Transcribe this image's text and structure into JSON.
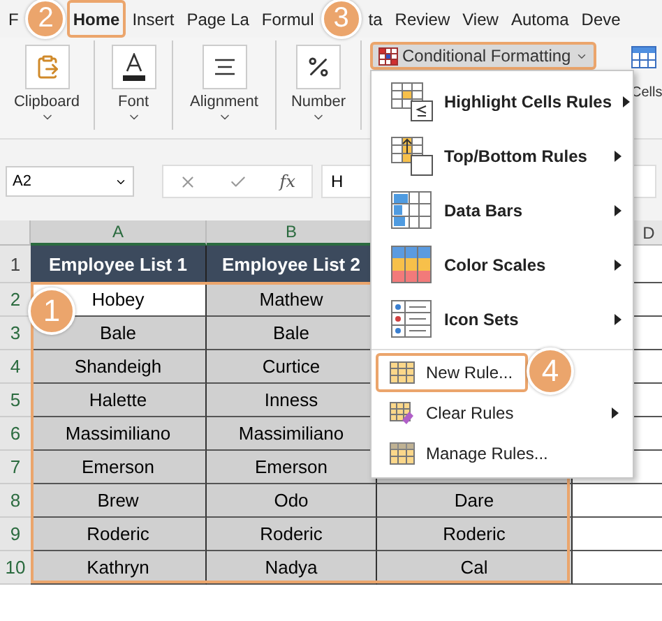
{
  "tabs": [
    {
      "label": "F",
      "selected": false
    },
    {
      "label": "Home",
      "selected": true
    },
    {
      "label": "Insert",
      "selected": false
    },
    {
      "label": "Page La",
      "selected": false
    },
    {
      "label": "Formul",
      "selected": false
    },
    {
      "label": "ta",
      "selected": false
    },
    {
      "label": "Review",
      "selected": false
    },
    {
      "label": "View",
      "selected": false
    },
    {
      "label": "Automa",
      "selected": false
    },
    {
      "label": "Deve",
      "selected": false
    }
  ],
  "ribbon": {
    "groups": [
      {
        "label": "Clipboard"
      },
      {
        "label": "Font"
      },
      {
        "label": "Alignment"
      },
      {
        "label": "Number"
      }
    ],
    "conditional_formatting": {
      "label": "Conditional Formatting",
      "expanded": true
    },
    "cells_group": {
      "label": "Cells"
    }
  },
  "formula_bar": {
    "name_box": "A2",
    "function_label": "fx",
    "value": "H"
  },
  "sheet": {
    "columns": [
      {
        "label": "A",
        "selected": true
      },
      {
        "label": "B",
        "selected": true
      },
      {
        "label": "D",
        "selected": false
      }
    ],
    "header_row": {
      "number": "1",
      "cells": [
        "Employee List 1",
        "Employee List 2"
      ]
    },
    "rows": [
      {
        "number": "2",
        "cells": [
          "Hobey",
          "Mathew"
        ]
      },
      {
        "number": "3",
        "cells": [
          "Bale",
          "Bale"
        ]
      },
      {
        "number": "4",
        "cells": [
          "Shandeigh",
          "Curtice"
        ]
      },
      {
        "number": "5",
        "cells": [
          "Halette",
          "Inness"
        ]
      },
      {
        "number": "6",
        "cells": [
          "Massimiliano",
          "Massimiliano"
        ]
      },
      {
        "number": "7",
        "cells": [
          "Emerson",
          "Emerson"
        ]
      },
      {
        "number": "8",
        "cells": [
          "Brew",
          "Odo",
          "Dare"
        ]
      },
      {
        "number": "9",
        "cells": [
          "Roderic",
          "Roderic",
          "Roderic"
        ]
      },
      {
        "number": "10",
        "cells": [
          "Kathryn",
          "Nadya",
          "Cal"
        ]
      }
    ]
  },
  "menu": {
    "items": [
      {
        "kind": "large",
        "label": "Highlight Cells Rules",
        "submenu": true,
        "selected": false
      },
      {
        "kind": "large",
        "label": "Top/Bottom Rules",
        "submenu": true,
        "selected": false
      },
      {
        "kind": "large",
        "label": "Data Bars",
        "submenu": true,
        "selected": false
      },
      {
        "kind": "large",
        "label": "Color Scales",
        "submenu": true,
        "selected": false
      },
      {
        "kind": "large",
        "label": "Icon Sets",
        "submenu": true,
        "selected": false
      },
      {
        "kind": "small",
        "label": "New Rule...",
        "submenu": false,
        "selected": true
      },
      {
        "kind": "small",
        "label": "Clear Rules",
        "submenu": true,
        "selected": false
      },
      {
        "kind": "small",
        "label": "Manage Rules...",
        "submenu": false,
        "selected": false
      }
    ]
  },
  "step_badges": [
    "1",
    "2",
    "3",
    "4"
  ]
}
